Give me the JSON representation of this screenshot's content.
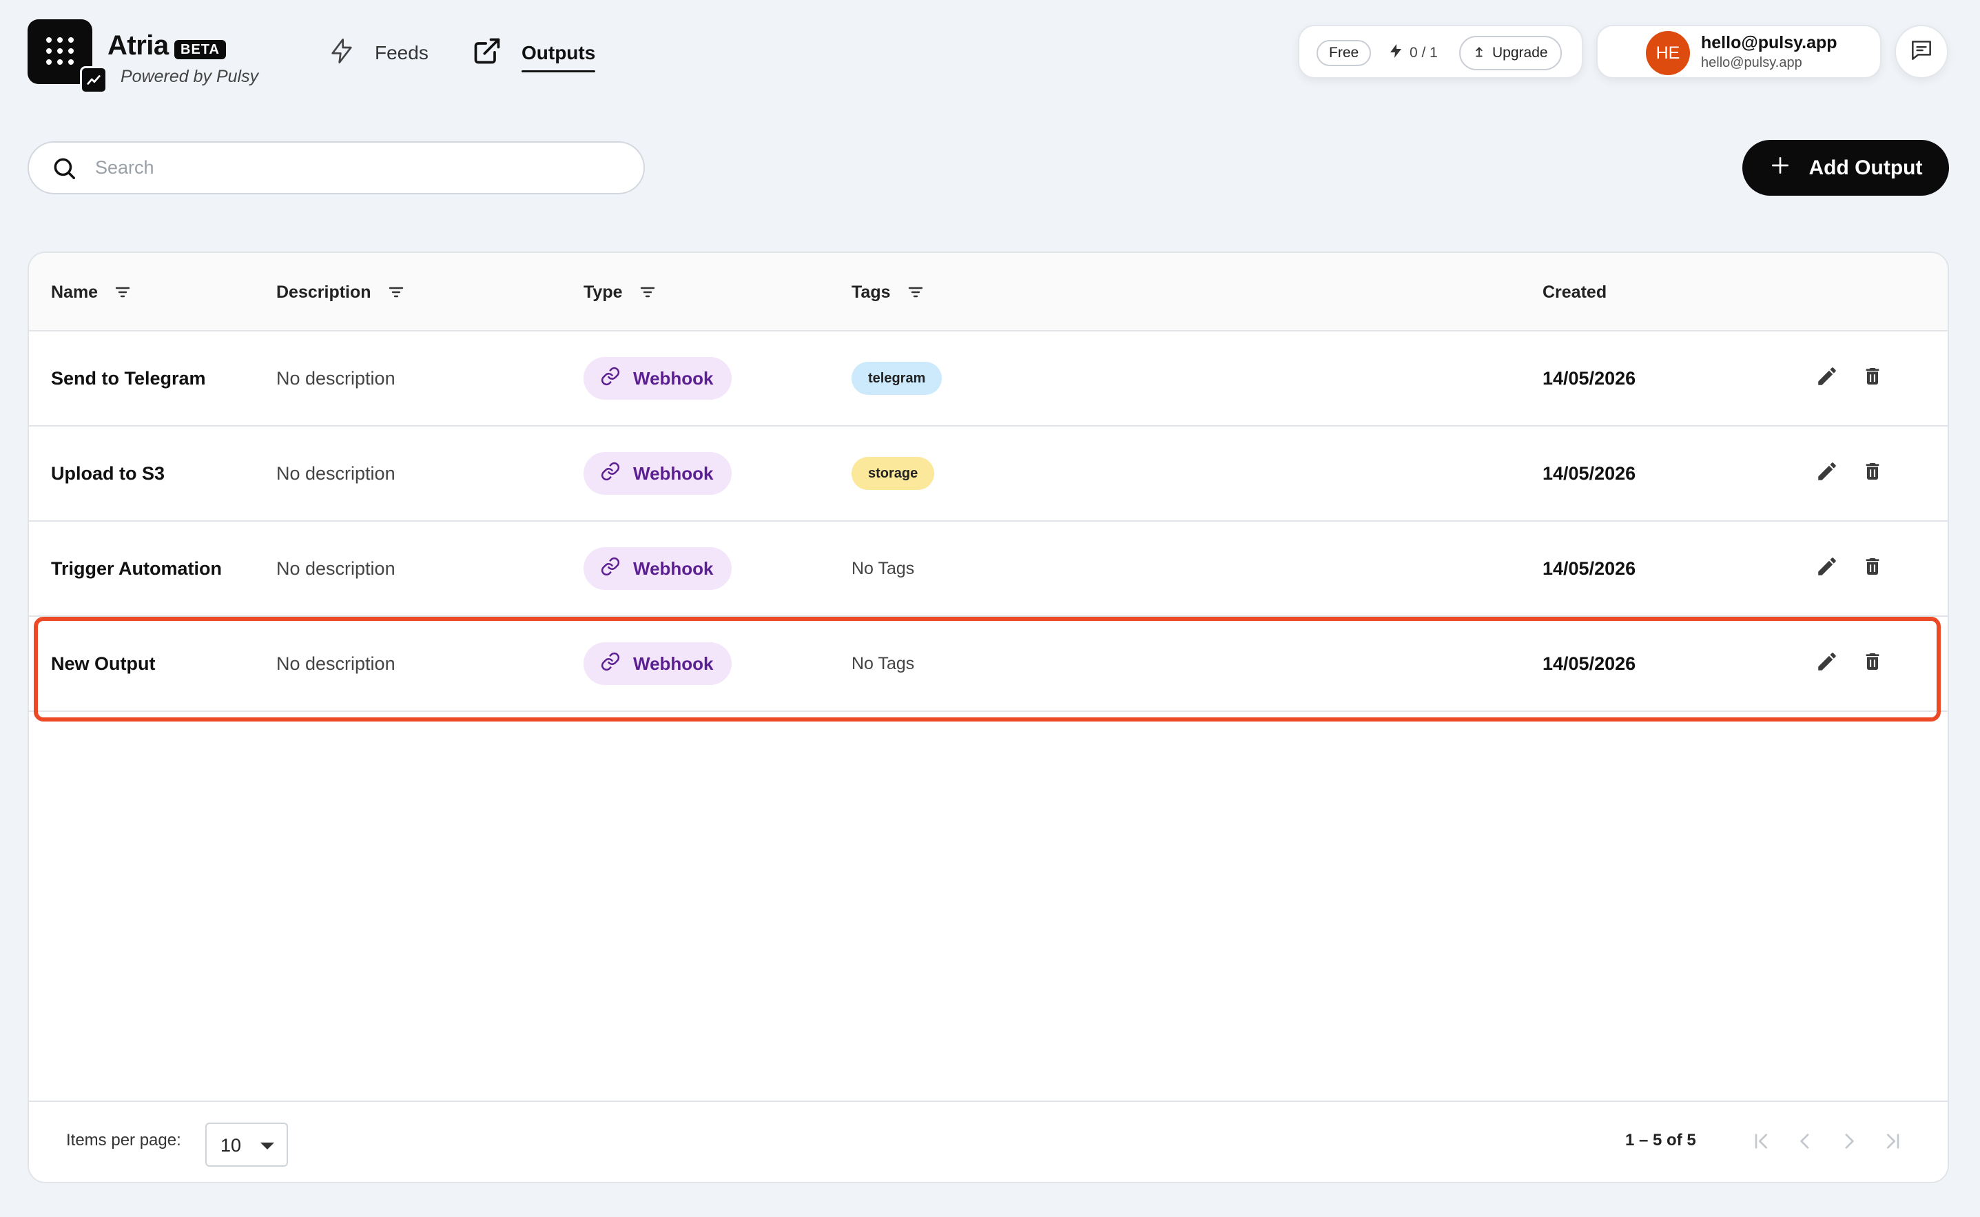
{
  "app": {
    "name": "Atria",
    "badge": "BETA",
    "subtitle": "Powered by Pulsy"
  },
  "nav": {
    "feeds_label": "Feeds",
    "outputs_label": "Outputs",
    "active": "Outputs"
  },
  "plan": {
    "tier": "Free",
    "usage": "0 / 1",
    "upgrade_label": "Upgrade"
  },
  "user": {
    "initials": "HE",
    "name": "hello@pulsy.app",
    "email": "hello@pulsy.app",
    "avatar_color": "#dd4b0f"
  },
  "toolbar": {
    "search_placeholder": "Search",
    "add_label": "Add Output"
  },
  "table": {
    "columns": [
      {
        "label": "Name",
        "filterable": true
      },
      {
        "label": "Description",
        "filterable": true
      },
      {
        "label": "Type",
        "filterable": true
      },
      {
        "label": "Tags",
        "filterable": true
      },
      {
        "label": "Created",
        "filterable": false
      }
    ],
    "rows": [
      {
        "name": "Send to Telegram",
        "description": "No description",
        "type": "Webhook",
        "tags": "telegram",
        "tag_color": "#cdeafd",
        "created": "14/05/2026"
      },
      {
        "name": "Upload to S3",
        "description": "No description",
        "type": "Webhook",
        "tags": "storage",
        "tag_color": "#fbe89a",
        "created": "14/05/2026"
      },
      {
        "name": "Trigger Automation",
        "description": "No description",
        "type": "Webhook",
        "tags": "No Tags",
        "tag_color": null,
        "created": "14/05/2026"
      },
      {
        "name": "New Output",
        "description": "No description",
        "type": "Webhook",
        "tags": "No Tags",
        "tag_color": null,
        "created": "14/05/2026",
        "highlighted": true
      }
    ]
  },
  "paginator": {
    "items_per_page_label": "Items per page:",
    "items_per_page": "10",
    "range": "1 – 5 of 5"
  },
  "colors": {
    "background": "#f0f3f8",
    "primary": "#0b0b0b",
    "type_chip_bg": "#f3e6fb",
    "type_chip_text": "#5b1f91",
    "highlight": "#ec4a26"
  }
}
